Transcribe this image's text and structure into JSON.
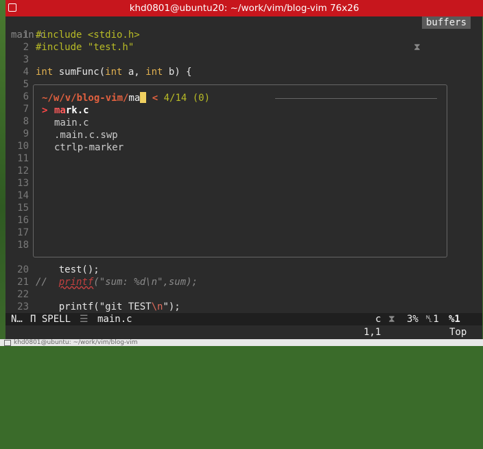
{
  "window": {
    "title": "khd0801@ubuntu20: ~/work/vim/blog-vim 76x26"
  },
  "tabline": {
    "file": "main.c",
    "separator_glyph": "⧗",
    "buffers_label": "buffers"
  },
  "editor": {
    "lines": [
      {
        "n": "1",
        "text": "#include <stdio.h>"
      },
      {
        "n": "2",
        "text": "#include \"test.h\""
      },
      {
        "n": "3",
        "text": ""
      },
      {
        "n": "4",
        "kw1": "int",
        "f": " sumFunc(",
        "kw2": "int",
        "a": " a, ",
        "kw3": "int",
        "b": " b) {"
      },
      {
        "n": "5",
        "text": ""
      },
      {
        "n": "6",
        "text": ""
      },
      {
        "n": "7",
        "text": ""
      },
      {
        "n": "8",
        "text": ""
      },
      {
        "n": "9",
        "text": ""
      },
      {
        "n": "10",
        "text": ""
      },
      {
        "n": "11",
        "text": ""
      },
      {
        "n": "12",
        "text": ""
      },
      {
        "n": "13",
        "text": ""
      },
      {
        "n": "14",
        "text": ""
      },
      {
        "n": "15",
        "text": ""
      },
      {
        "n": "16",
        "text": ""
      },
      {
        "n": "17",
        "text": ""
      },
      {
        "n": "18",
        "text": ""
      },
      {
        "n": "",
        "text": ""
      },
      {
        "n": "20",
        "text": "    test();"
      },
      {
        "n": "21",
        "c1": "//  ",
        "c2": "printf",
        "c3": "(\"sum: %d\\n\",sum);"
      },
      {
        "n": "22",
        "text": ""
      },
      {
        "n": "23",
        "p1": "    printf(\"git TEST",
        "p2": "\\n",
        "p3": "\");"
      }
    ]
  },
  "ctrlp": {
    "path": "~/w/v/blog-vim/",
    "input": "ma",
    "indicator": "<",
    "count": "4/14 (0)",
    "selected_marker": ">",
    "items": [
      {
        "pre": "",
        "match": "ma",
        "post": "rk.c",
        "selected": true
      },
      {
        "pre": "main.c",
        "match": "",
        "post": "",
        "selected": false
      },
      {
        "pre": ".main.c.swp",
        "match": "",
        "post": "",
        "selected": false
      },
      {
        "pre": "ctrlp-marker",
        "match": "",
        "post": "",
        "selected": false
      }
    ]
  },
  "statusline": {
    "mode": "N…",
    "spell": "Π SPELL",
    "sep_glyph": "☰",
    "file": "main.c",
    "filetype": "c",
    "sep2": "⧗",
    "percent": "3%",
    "line_icon": "␤1",
    "col": "%1"
  },
  "cmdline": {
    "position": "1,1",
    "scroll": "Top"
  },
  "gnome_bar": {
    "text": "khd0801@ubuntu: ~/work/vim/blog-vim"
  },
  "colors": {
    "titlebar": "#c7161d",
    "background": "#2b2b2b",
    "accent_path": "#e0603f",
    "cursor": "#f0d060",
    "preproc": "#b8bb26"
  }
}
